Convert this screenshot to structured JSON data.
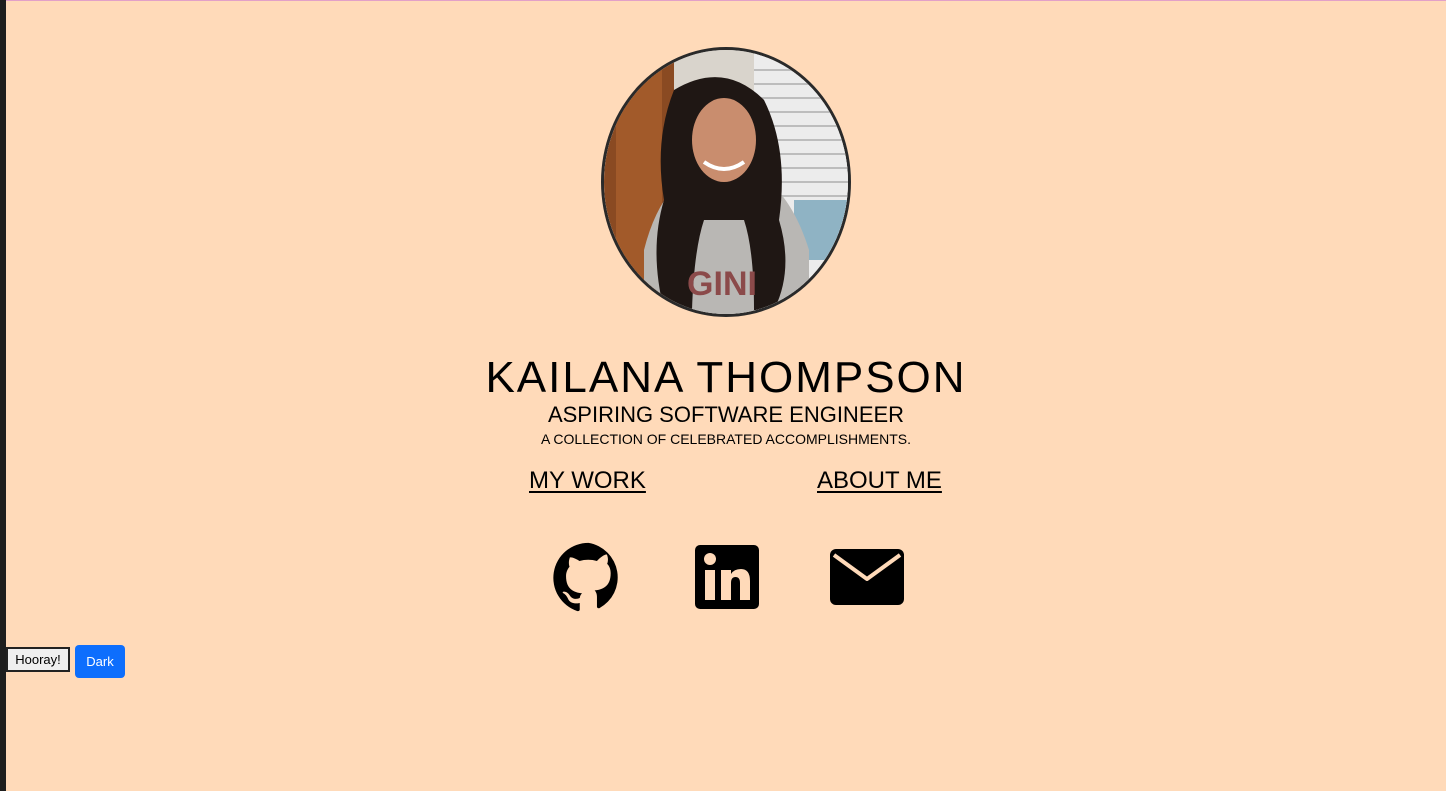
{
  "profile": {
    "name": "KAILANA THOMPSON",
    "subtitle": "ASPIRING SOFTWARE ENGINEER",
    "tagline": "A COLLECTION OF CELEBRATED ACCOMPLISHMENTS.",
    "photo_alt": "profile photo"
  },
  "nav": {
    "work": "MY WORK",
    "about": "ABOUT ME"
  },
  "social": [
    {
      "icon": "github-icon"
    },
    {
      "icon": "linkedin-icon"
    },
    {
      "icon": "envelope-icon"
    }
  ],
  "controls": {
    "hooray_label": "Hooray!",
    "dark_label": "Dark"
  },
  "colors": {
    "background": "#FFDAB9",
    "accent_button": "#0d6efd",
    "text": "#000000"
  }
}
